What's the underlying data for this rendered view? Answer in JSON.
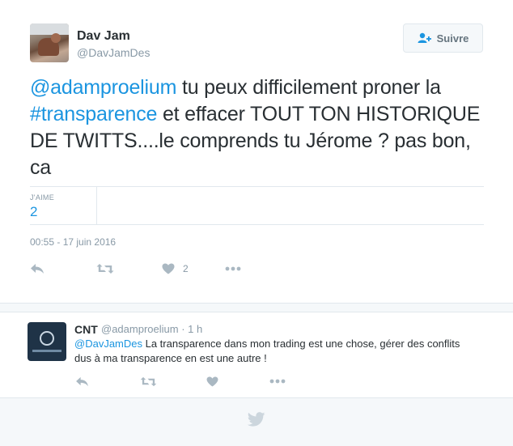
{
  "tweet": {
    "author_name": "Dav Jam",
    "author_handle": "@DavJamDes",
    "follow_label": "Suivre",
    "text_parts": {
      "mention": "@adamproelium",
      "t1": " tu peux difficilement proner la ",
      "hashtag": "#transparence",
      "t2": " et effacer TOUT TON HISTORIQUE DE TWITTS....le comprends tu Jérome ? pas bon, ca"
    },
    "likes_label": "J'AIME",
    "likes_count": "2",
    "timestamp": "00:55 - 17 juin 2016",
    "action_like_count": "2"
  },
  "reply": {
    "author_name": "CNT",
    "author_handle": "@adamproelium",
    "separator": " · ",
    "time": "1 h",
    "mention": "@DavJamDes",
    "text": " La transparence dans mon trading est une chose, gérer des conflits dus à ma transparence en est une autre !"
  },
  "icons": [
    "reply-icon",
    "retweet-icon",
    "heart-icon",
    "more-icon",
    "follow-user-icon",
    "twitter-bird-icon"
  ],
  "colors": {
    "link": "#1b95e0",
    "muted": "#8899a6",
    "text": "#292f33",
    "border": "#e1e8ed",
    "background_alt": "#f5f8fa"
  }
}
